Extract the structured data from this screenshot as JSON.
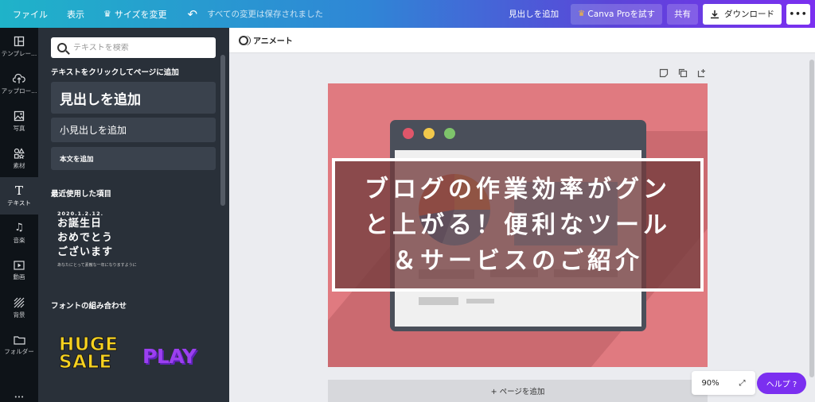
{
  "topbar": {
    "file": "ファイル",
    "view": "表示",
    "resize": "サイズを変更",
    "saved": "すべての変更は保存されました",
    "add_heading": "見出しを追加",
    "pro": "Canva Proを試す",
    "share": "共有",
    "download": "ダウンロード",
    "more": "•••"
  },
  "rail": {
    "items": [
      {
        "label": "テンプレー...",
        "icon": "template-icon"
      },
      {
        "label": "アップロー...",
        "icon": "upload-icon"
      },
      {
        "label": "写真",
        "icon": "photo-icon"
      },
      {
        "label": "素材",
        "icon": "elements-icon"
      },
      {
        "label": "テキスト",
        "icon": "text-icon"
      },
      {
        "label": "音楽",
        "icon": "music-icon"
      },
      {
        "label": "動画",
        "icon": "video-icon"
      },
      {
        "label": "背景",
        "icon": "background-icon"
      },
      {
        "label": "フォルダー",
        "icon": "folder-icon"
      }
    ],
    "more": "•••"
  },
  "panel": {
    "search_placeholder": "テキストを検索",
    "section_add": "テキストをクリックしてページに追加",
    "heading_btn": "見出しを追加",
    "subheading_btn": "小見出しを追加",
    "body_btn": "本文を追加",
    "section_recent": "最近使用した項目",
    "recent": {
      "date": "2020.1.2.12.",
      "line1": "お誕生日",
      "line2": "おめでとう",
      "line3": "ございます",
      "small": "あなたにとって素敵な一年になりますように"
    },
    "section_fonts": "フォントの組み合わせ",
    "huge_line1": "HUGE",
    "huge_line2": "SALE",
    "play": "PLAY"
  },
  "editor": {
    "animate": "アニメート",
    "title_lines": [
      "ブログの作業効率がグン",
      "と上がる！便利なツール",
      "＆サービスのご紹介"
    ],
    "add_page": "+ ページを追加",
    "zoom": "90%",
    "help": "ヘルプ ?"
  },
  "colors": {
    "canvas_bg": "#e07a80",
    "overlay": "#733c3e",
    "accent": "#7b2ff0"
  }
}
